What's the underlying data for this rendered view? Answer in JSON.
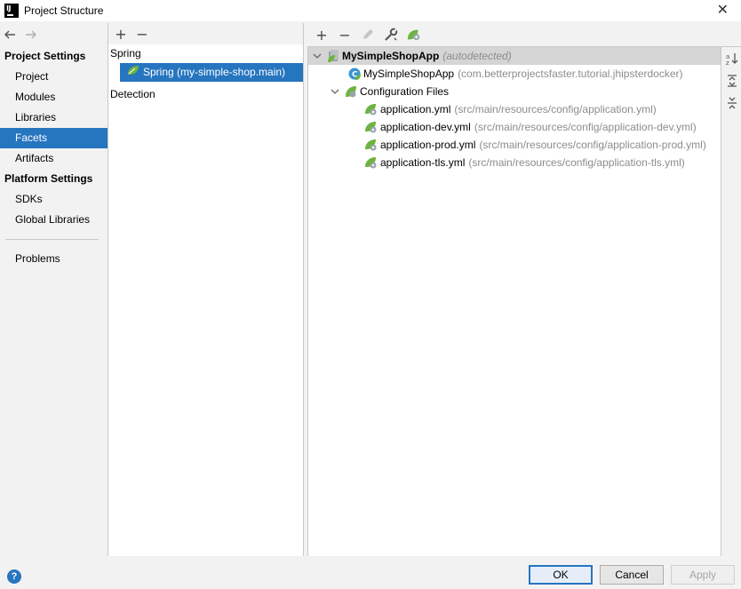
{
  "window": {
    "title": "Project Structure",
    "logo_text": "IJ",
    "close_glyph": "✕"
  },
  "sidebar": {
    "sections": [
      {
        "header": "Project Settings",
        "items": [
          "Project",
          "Modules",
          "Libraries",
          "Facets",
          "Artifacts"
        ]
      },
      {
        "header": "Platform Settings",
        "items": [
          "SDKs",
          "Global Libraries"
        ]
      }
    ],
    "extra_item": "Problems",
    "selected": "Facets"
  },
  "middle": {
    "toolbar": {
      "add": "+",
      "remove": "−"
    },
    "groups": [
      {
        "label": "Spring",
        "items": [
          "Spring (my-simple-shop.main)"
        ]
      },
      {
        "label": "Detection",
        "items": []
      }
    ]
  },
  "right": {
    "toolbar": {
      "add": "+",
      "remove": "−"
    },
    "tree": {
      "root": {
        "label": "MySimpleShopApp",
        "note": "(autodetected)"
      },
      "app_class": {
        "label": "MySimpleShopApp",
        "note": "(com.betterprojectsfaster.tutorial.jhipsterdocker)"
      },
      "config_folder": {
        "label": "Configuration Files"
      },
      "files": [
        {
          "label": "application.yml",
          "path": "(src/main/resources/config/application.yml)"
        },
        {
          "label": "application-dev.yml",
          "path": "(src/main/resources/config/application-dev.yml)"
        },
        {
          "label": "application-prod.yml",
          "path": "(src/main/resources/config/application-prod.yml)"
        },
        {
          "label": "application-tls.yml",
          "path": "(src/main/resources/config/application-tls.yml)"
        }
      ]
    }
  },
  "footer": {
    "help": "?",
    "ok": "OK",
    "cancel": "Cancel",
    "apply": "Apply"
  },
  "colors": {
    "accent": "#2675bf",
    "spring_green": "#6db33f",
    "selection_gray": "#d5d5d5"
  }
}
